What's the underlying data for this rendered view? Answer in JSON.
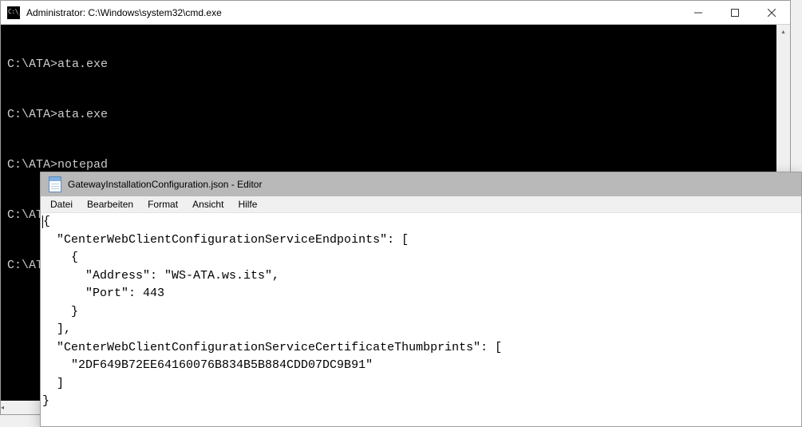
{
  "cmd": {
    "title": "Administrator: C:\\Windows\\system32\\cmd.exe",
    "lines": [
      "C:\\ATA>ata.exe",
      "",
      "C:\\ATA>ata.exe",
      "",
      "C:\\ATA>notepad",
      "",
      "C:\\ATA>notepad GatewayInstallationConfiguration.json",
      "",
      "C:\\ATA>"
    ]
  },
  "notepad": {
    "title": "GatewayInstallationConfiguration.json - Editor",
    "menu": {
      "file": "Datei",
      "edit": "Bearbeiten",
      "format": "Format",
      "view": "Ansicht",
      "help": "Hilfe"
    },
    "content": "{\n  \"CenterWebClientConfigurationServiceEndpoints\": [\n    {\n      \"Address\": \"WS-ATA.ws.its\",\n      \"Port\": 443\n    }\n  ],\n  \"CenterWebClientConfigurationServiceCertificateThumbprints\": [\n    \"2DF649B72EE64160076B834B5B884CDD07DC9B91\"\n  ]\n}"
  }
}
